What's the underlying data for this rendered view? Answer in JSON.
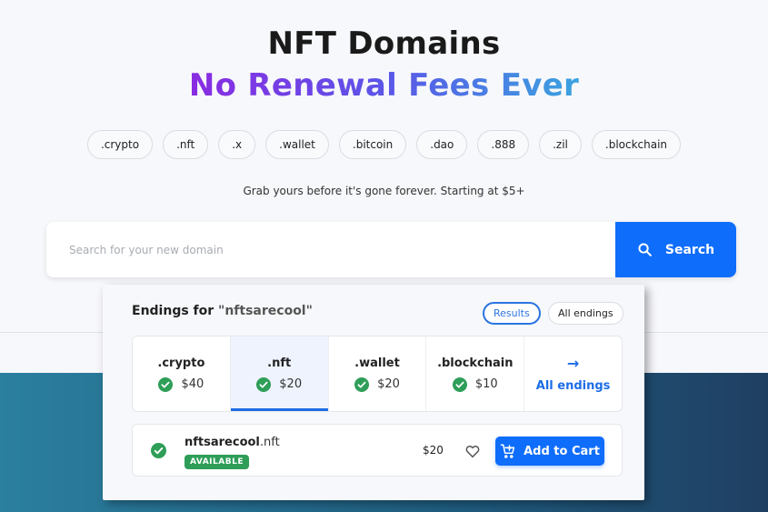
{
  "hero": {
    "title": "NFT Domains",
    "subtitle": "No Renewal Fees Ever",
    "gradient_colors": [
      "#8a2be2",
      "#5b55e8",
      "#3aa3df"
    ]
  },
  "tld_chips": [
    ".crypto",
    ".nft",
    ".x",
    ".wallet",
    ".bitcoin",
    ".dao",
    ".888",
    ".zil",
    ".blockchain"
  ],
  "tagline": "Grab yours before it's gone forever. Starting at $5+",
  "search": {
    "placeholder": "Search for your new domain",
    "value": "",
    "button_label": "Search",
    "button_color": "#0f6dfb"
  },
  "panel": {
    "title_prefix": "Endings for",
    "query": "\"nftsarecool\"",
    "toggles": {
      "results": "Results",
      "all": "All endings",
      "active": "results"
    },
    "endings": [
      {
        "name": ".crypto",
        "price": "$40",
        "available": true,
        "active": false
      },
      {
        "name": ".nft",
        "price": "$20",
        "available": true,
        "active": true
      },
      {
        "name": ".wallet",
        "price": "$20",
        "available": true,
        "active": false
      },
      {
        "name": ".blockchain",
        "price": "$10",
        "available": true,
        "active": false
      }
    ],
    "all_endings_link": {
      "arrow": "→",
      "label": "All endings"
    },
    "result": {
      "name": "nftsarecool",
      "tld": ".nft",
      "status": "AVAILABLE",
      "price": "$20",
      "cart_label": "Add to Cart"
    },
    "accent_color": "#1d6de6",
    "success_color": "#2e9e58"
  }
}
